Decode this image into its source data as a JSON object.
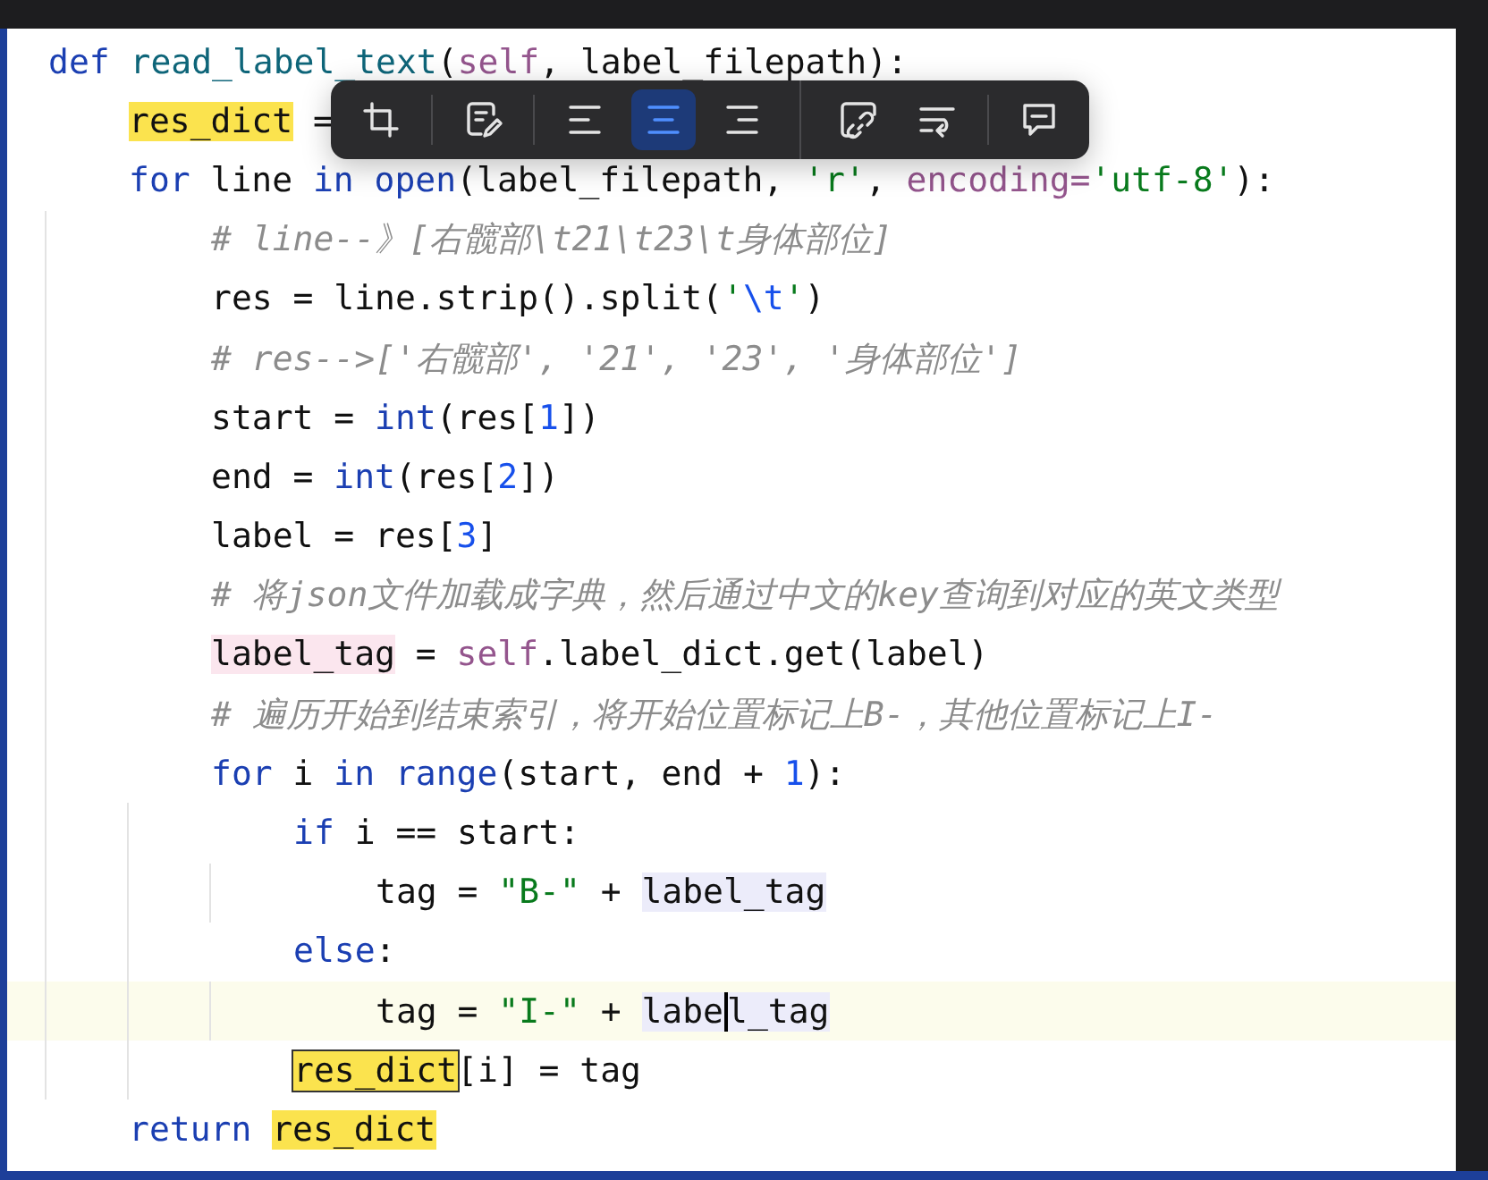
{
  "toolbar": {
    "groups": [
      [
        {
          "selected": false
        }
      ],
      [
        {
          "selected": false
        }
      ],
      [
        {
          "selected": false
        },
        {
          "selected": true
        },
        {
          "selected": false
        }
      ],
      [
        {
          "selected": false
        },
        {
          "selected": false
        }
      ],
      [
        {
          "selected": false
        }
      ]
    ]
  },
  "code": [
    {
      "tokens": [
        {
          "text": "def ",
          "kind": "keyword"
        },
        {
          "text": "read_label_text",
          "kind": "function"
        },
        {
          "text": "(",
          "kind": "plain"
        },
        {
          "text": "self",
          "kind": "self"
        },
        {
          "text": ", label_filepath):",
          "kind": "plain"
        }
      ],
      "children": [
        {
          "tokens": [
            {
              "text": "res_dict",
              "kind": "plain",
              "color": "#fbe34e"
            },
            {
              "text": " =",
              "kind": "plain"
            }
          ]
        },
        {
          "tokens": [
            {
              "text": "for ",
              "kind": "keyword"
            },
            {
              "text": "line ",
              "kind": "plain"
            },
            {
              "text": "in ",
              "kind": "keyword"
            },
            {
              "text": "open",
              "kind": "builtin"
            },
            {
              "text": "(label_filepath, ",
              "kind": "plain"
            },
            {
              "text": "'r'",
              "kind": "string"
            },
            {
              "text": ", ",
              "kind": "plain"
            },
            {
              "text": "encoding=",
              "kind": "self"
            },
            {
              "text": "'utf-8'",
              "kind": "string"
            },
            {
              "text": "):",
              "kind": "plain"
            }
          ],
          "children": [
            {
              "tokens": [
                {
                  "text": "# line--》[右髋部\\t21\\t23\\t身体部位]",
                  "kind": "comment"
                }
              ]
            },
            {
              "tokens": [
                {
                  "text": "res = line.strip().split(",
                  "kind": "plain"
                },
                {
                  "text": "'",
                  "kind": "string"
                },
                {
                  "text": "\\t",
                  "kind": "number"
                },
                {
                  "text": "'",
                  "kind": "string"
                },
                {
                  "text": ")",
                  "kind": "plain"
                }
              ]
            },
            {
              "tokens": [
                {
                  "text": "# res-->['右髋部', '21', '23', '身体部位']",
                  "kind": "comment"
                }
              ]
            },
            {
              "tokens": [
                {
                  "text": "start = ",
                  "kind": "plain"
                },
                {
                  "text": "int",
                  "kind": "builtin"
                },
                {
                  "text": "(res[",
                  "kind": "plain"
                },
                {
                  "text": "1",
                  "kind": "number"
                },
                {
                  "text": "])",
                  "kind": "plain"
                }
              ]
            },
            {
              "tokens": [
                {
                  "text": "end = ",
                  "kind": "plain"
                },
                {
                  "text": "int",
                  "kind": "builtin"
                },
                {
                  "text": "(res[",
                  "kind": "plain"
                },
                {
                  "text": "2",
                  "kind": "number"
                },
                {
                  "text": "])",
                  "kind": "plain"
                }
              ]
            },
            {
              "tokens": [
                {
                  "text": "label = res[",
                  "kind": "plain"
                },
                {
                  "text": "3",
                  "kind": "number"
                },
                {
                  "text": "]",
                  "kind": "plain"
                }
              ]
            },
            {
              "tokens": [
                {
                  "text": "# 将json文件加载成字典，然后通过中文的key查询到对应的英文类型",
                  "kind": "comment"
                }
              ]
            },
            {
              "tokens": [
                {
                  "text": "label_tag",
                  "kind": "plain",
                  "color": "#fbe6ee"
                },
                {
                  "text": " = ",
                  "kind": "plain"
                },
                {
                  "text": "self",
                  "kind": "self"
                },
                {
                  "text": ".label_dict.get(label)",
                  "kind": "plain"
                }
              ]
            },
            {
              "tokens": [
                {
                  "text": "# 遍历开始到结束索引，将开始位置标记上B-，其他位置标记上I-",
                  "kind": "comment"
                }
              ]
            },
            {
              "tokens": [
                {
                  "text": "for ",
                  "kind": "keyword"
                },
                {
                  "text": "i ",
                  "kind": "plain"
                },
                {
                  "text": "in ",
                  "kind": "keyword"
                },
                {
                  "text": "range",
                  "kind": "builtin"
                },
                {
                  "text": "(start, end + ",
                  "kind": "plain"
                },
                {
                  "text": "1",
                  "kind": "number"
                },
                {
                  "text": "):",
                  "kind": "plain"
                }
              ],
              "children": [
                {
                  "tokens": [
                    {
                      "text": "if ",
                      "kind": "keyword"
                    },
                    {
                      "text": "i == start:",
                      "kind": "plain"
                    }
                  ],
                  "children": [
                    {
                      "tokens": [
                        {
                          "text": "tag = ",
                          "kind": "plain"
                        },
                        {
                          "text": "\"B-\"",
                          "kind": "string"
                        },
                        {
                          "text": " + ",
                          "kind": "plain"
                        },
                        {
                          "text": "label_tag",
                          "kind": "plain",
                          "color": "#ececfa"
                        }
                      ]
                    }
                  ]
                },
                {
                  "tokens": [
                    {
                      "text": "else",
                      "kind": "keyword"
                    },
                    {
                      "text": ":",
                      "kind": "plain"
                    }
                  ],
                  "children": [
                    {
                      "current": true,
                      "tokens": [
                        {
                          "text": "tag = ",
                          "kind": "plain"
                        },
                        {
                          "text": "\"I-\"",
                          "kind": "string"
                        },
                        {
                          "text": " + ",
                          "kind": "plain"
                        },
                        {
                          "text": "labe",
                          "kind": "plain",
                          "color": "#ececfa"
                        },
                        {
                          "text": "l_tag",
                          "kind": "plain",
                          "color": "#ececfa",
                          "caret": true
                        }
                      ]
                    }
                  ]
                },
                {
                  "tokens": [
                    {
                      "text": "res_dict",
                      "kind": "plain",
                      "color": "#fbe34e",
                      "boxed": true
                    },
                    {
                      "text": "[i] = tag",
                      "kind": "plain"
                    }
                  ]
                }
              ]
            }
          ]
        },
        {
          "tokens": [
            {
              "text": "return ",
              "kind": "keyword"
            },
            {
              "text": "res_dict",
              "kind": "plain",
              "color": "#fbe34e"
            }
          ]
        }
      ]
    }
  ]
}
